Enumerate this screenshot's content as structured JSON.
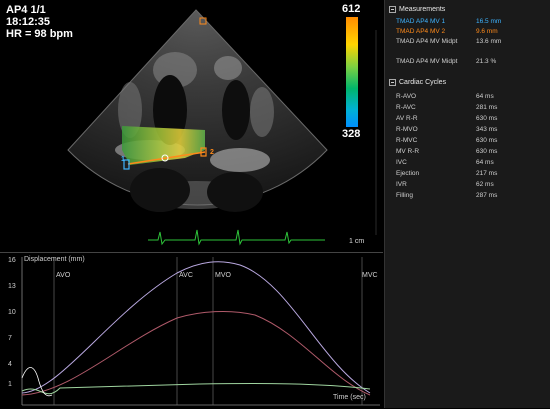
{
  "echo": {
    "view_label": "AP4  1/1",
    "time": "18:12:35",
    "heart_rate": "HR = 98 bpm",
    "colorbar_max": "612",
    "colorbar_min": "328",
    "scale_label": "1 cm",
    "marker_1": "1",
    "marker_2": "2"
  },
  "panel": {
    "measurements_title": "Measurements",
    "cardiac_title": "Cardiac Cycles",
    "measurements": [
      {
        "label": "TMAD AP4 MV 1",
        "value": "16.5 mm",
        "color": "#3fb4ff"
      },
      {
        "label": "TMAD AP4 MV 2",
        "value": "9.6 mm",
        "color": "#ff8a1a"
      },
      {
        "label": "TMAD AP4 MV Midpt",
        "value": "13.6 mm",
        "color": "#cfcfcf"
      },
      {
        "label": "TMAD AP4 MV Midpt",
        "value": "21.3 %",
        "color": "#cfcfcf"
      }
    ],
    "cycles": [
      {
        "label": "R-AVO",
        "value": "64 ms"
      },
      {
        "label": "R-AVC",
        "value": "281 ms"
      },
      {
        "label": "AV R-R",
        "value": "630 ms"
      },
      {
        "label": "R-MVO",
        "value": "343 ms"
      },
      {
        "label": "R-MVC",
        "value": "630 ms"
      },
      {
        "label": "MV R-R",
        "value": "630 ms"
      },
      {
        "label": "IVC",
        "value": "64 ms"
      },
      {
        "label": "Ejection",
        "value": "217 ms"
      },
      {
        "label": "IVR",
        "value": "62 ms"
      },
      {
        "label": "Filling",
        "value": "287 ms"
      }
    ]
  },
  "graph": {
    "ylabel": "Displacement (mm)",
    "xlabel": "Time (sec)",
    "yticks": [
      "16",
      "13",
      "10",
      "7",
      "4",
      "1"
    ],
    "events": [
      "AVO",
      "AVC",
      "MVO",
      "MVC"
    ]
  },
  "colors": {
    "curve_1": "#b9a8e0",
    "curve_2": "#b05a6a",
    "curve_3": "#9fd49f",
    "ecg": "#2ec43a"
  }
}
